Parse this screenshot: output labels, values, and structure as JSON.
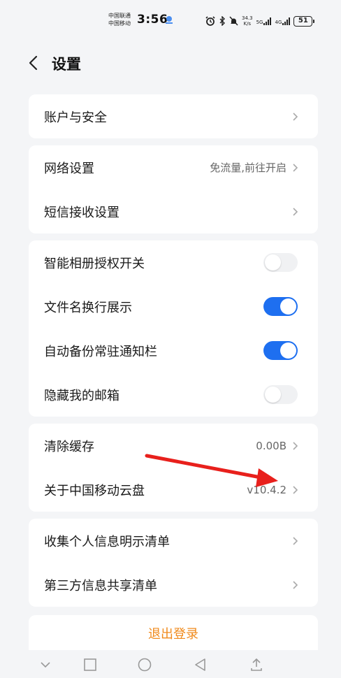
{
  "status": {
    "carrier1": "中国联通",
    "carrier2": "中国移动",
    "time": "3:56",
    "speed_value": "34.3",
    "speed_unit": "K/s",
    "net1": "5G",
    "net2": "4G",
    "battery": "51"
  },
  "header": {
    "title": "设置"
  },
  "groups": [
    {
      "rows": [
        {
          "label": "账户与安全",
          "value": ""
        }
      ]
    },
    {
      "rows": [
        {
          "label": "网络设置",
          "value": "免流量,前往开启"
        },
        {
          "label": "短信接收设置",
          "value": ""
        }
      ]
    },
    {
      "rows": [
        {
          "label": "智能相册授权开关",
          "toggle": false
        },
        {
          "label": "文件名换行展示",
          "toggle": true
        },
        {
          "label": "自动备份常驻通知栏",
          "toggle": true
        },
        {
          "label": "隐藏我的邮箱",
          "toggle": false
        }
      ]
    },
    {
      "rows": [
        {
          "label": "清除缓存",
          "value": "0.00B"
        },
        {
          "label": "关于中国移动云盘",
          "value": "v10.4.2"
        }
      ]
    },
    {
      "rows": [
        {
          "label": "收集个人信息明示清单",
          "value": ""
        },
        {
          "label": "第三方信息共享清单",
          "value": ""
        }
      ]
    }
  ],
  "logout_label": "退出登录",
  "colors": {
    "accent": "#1e6ff0",
    "logout": "#f08a1c",
    "annotation_arrow": "#e8201c"
  },
  "icons": [
    "back-chevron-icon",
    "chevron-right-icon",
    "nav-back-icon",
    "nav-home-icon",
    "nav-recents-icon",
    "nav-down-icon",
    "nav-up-icon"
  ]
}
